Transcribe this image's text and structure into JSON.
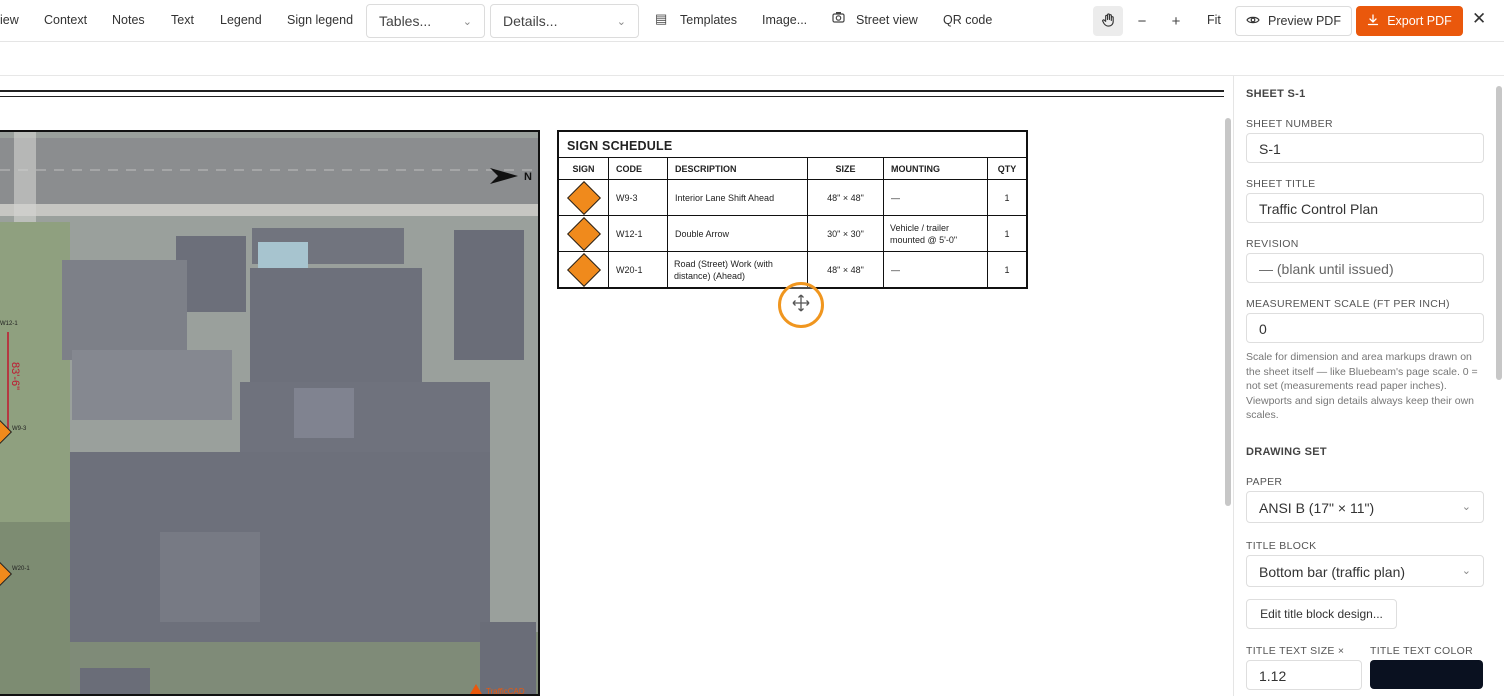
{
  "toolbar": {
    "items": [
      "iew",
      "Context",
      "Notes",
      "Text",
      "Legend",
      "Sign legend"
    ],
    "tables_select": "Tables...",
    "details_select": "Details...",
    "templates": "Templates",
    "image": "Image...",
    "street_view": "Street view",
    "qr_code": "QR code",
    "zoom_out": "−",
    "zoom_in": "+",
    "fit": "Fit",
    "preview_pdf": "Preview PDF",
    "export_pdf": "Export PDF",
    "close": "✕",
    "accent_color": "#ea580c"
  },
  "map": {
    "north_label": "N",
    "dimension_label": "83'-6\"",
    "watermark": "TrafficCAD",
    "sign_labels": [
      "W12-1",
      "W9-3",
      "W20-1"
    ]
  },
  "schedule": {
    "title": "SIGN SCHEDULE",
    "columns": [
      "SIGN",
      "CODE",
      "DESCRIPTION",
      "SIZE",
      "MOUNTING",
      "QTY"
    ],
    "rows": [
      {
        "code": "W9-3",
        "description": "Interior Lane Shift Ahead",
        "size": "48\" × 48\"",
        "mounting": "—",
        "qty": "1"
      },
      {
        "code": "W12-1",
        "description": "Double Arrow",
        "size": "30\" × 30\"",
        "mounting": "Vehicle / trailer mounted @ 5'-0\"",
        "qty": "1"
      },
      {
        "code": "W20-1",
        "description": "Road (Street) Work (with distance) (Ahead)",
        "size": "48\" × 48\"",
        "mounting": "—",
        "qty": "1"
      }
    ]
  },
  "panel": {
    "sheet_heading": "SHEET S-1",
    "sheet_number_label": "SHEET NUMBER",
    "sheet_number": "S-1",
    "sheet_title_label": "SHEET TITLE",
    "sheet_title": "Traffic Control Plan",
    "revision_label": "REVISION",
    "revision_placeholder": "— (blank until issued)",
    "scale_label": "MEASUREMENT SCALE (FT PER INCH)",
    "scale_value": "0",
    "scale_help": "Scale for dimension and area markups drawn on the sheet itself — like Bluebeam's page scale. 0 = not set (measurements read paper inches). Viewports and sign details always keep their own scales.",
    "drawing_set": "DRAWING SET",
    "paper_label": "PAPER",
    "paper_value": "ANSI B (17\" × 11\")",
    "title_block_label": "TITLE BLOCK",
    "title_block_value": "Bottom bar (traffic plan)",
    "edit_title_block": "Edit title block design...",
    "title_text_size_label": "TITLE TEXT SIZE ×",
    "title_text_size": "1.12",
    "title_text_color_label": "TITLE TEXT COLOR",
    "title_text_color": "#0a1120"
  }
}
